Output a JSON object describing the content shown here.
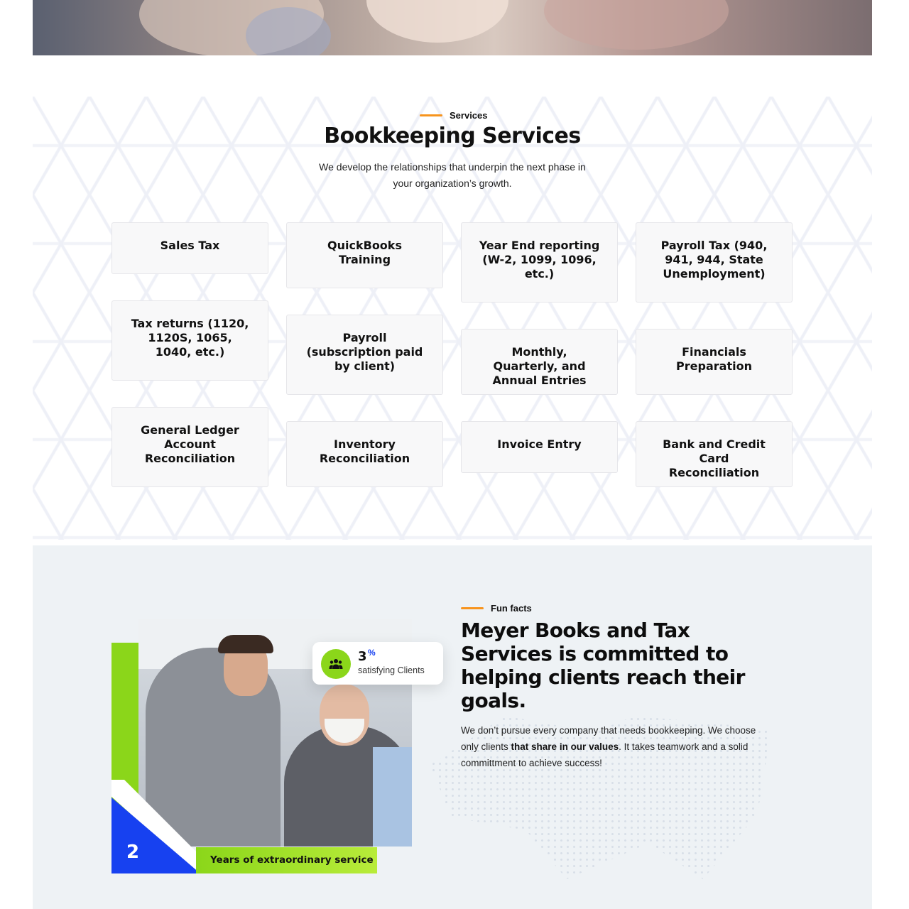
{
  "services": {
    "eyebrow": "Services",
    "title": "Bookkeeping Services",
    "subtitle": "We develop the relationships that underpin the next phase in your organization’s growth.",
    "cards": [
      "Sales Tax",
      "QuickBooks Training",
      "Year End reporting (W-2, 1099, 1096, etc.)",
      "Payroll Tax (940, 941, 944, State Unemployment)",
      "Tax returns (1120, 1120S, 1065, 1040, etc.)",
      "Payroll (subscription paid by client)",
      "Monthly, Quarterly, and Annual Entries",
      "Financials Preparation",
      "General Ledger Account Reconciliation",
      "Inventory Reconciliation",
      "Invoice Entry",
      "Bank and Credit Card Reconciliation"
    ]
  },
  "facts": {
    "eyebrow": "Fun facts",
    "title": "Meyer Books and Tax Services is committed to helping clients reach their goals.",
    "text_before": "We don’t pursue every company that needs bookkeeping. We choose only clients ",
    "text_bold": "that share in our values",
    "text_after": ". It takes teamwork and a solid committment to achieve success!",
    "stat": {
      "value": "3",
      "unit": "%",
      "label": "satisfying Clients",
      "icon": "users-icon"
    },
    "years": {
      "value": "2",
      "label": "Years of extraordinary service"
    }
  },
  "colors": {
    "accent_orange": "#f7941d",
    "accent_green": "#8bd61a",
    "accent_blue": "#1741f0"
  }
}
